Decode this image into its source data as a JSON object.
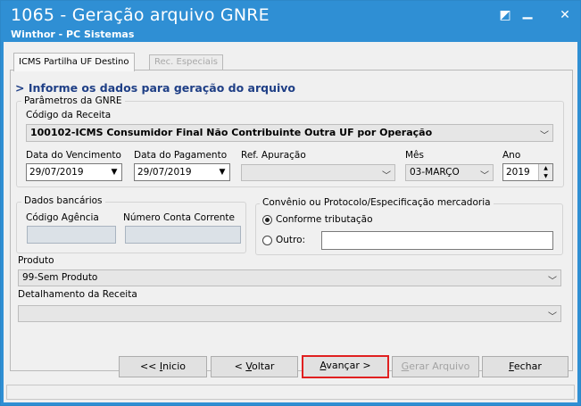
{
  "window": {
    "title": "1065 - Geração arquivo GNRE",
    "subtitle": "Winthor - PC Sistemas",
    "controls": {
      "restore": "◩",
      "minimize": "▁",
      "close": "✕"
    }
  },
  "tabs": [
    {
      "label": "ICMS Partilha UF Destino",
      "active": true
    },
    {
      "label": "Rec. Especiais",
      "active": false
    }
  ],
  "heading": "> Informe os dados para geração do arquivo",
  "parametros": {
    "group_label": "Parâmetros da GNRE",
    "codigo_receita_label": "Código da Receita",
    "codigo_receita_value": "100102-ICMS Consumidor Final Não Contribuinte Outra UF por Operação",
    "data_vencimento_label": "Data do Vencimento",
    "data_vencimento_value": "29/07/2019",
    "data_pagamento_label": "Data do Pagamento",
    "data_pagamento_value": "29/07/2019",
    "ref_apuracao_label": "Ref. Apuração",
    "ref_apuracao_value": "",
    "mes_label": "Mês",
    "mes_value": "03-MARÇO",
    "ano_label": "Ano",
    "ano_value": "2019"
  },
  "bancarios": {
    "group_label": "Dados bancários",
    "agencia_label": "Código Agência",
    "conta_label": "Número Conta Corrente"
  },
  "convenio": {
    "group_label": "Convênio ou Protocolo/Especificação mercadoria",
    "option1": "Conforme tributação",
    "option2": "Outro:",
    "selected": "Conforme tributação"
  },
  "produto": {
    "label": "Produto",
    "value": "99-Sem Produto"
  },
  "detalhamento": {
    "label": "Detalhamento da Receita",
    "value": ""
  },
  "buttons": {
    "inicio": {
      "prefix": "<< ",
      "key": "I",
      "rest": "nicio"
    },
    "voltar": {
      "prefix": "< ",
      "key": "V",
      "rest": "oltar"
    },
    "avancar": {
      "key": "A",
      "rest": "vançar >"
    },
    "gerar": {
      "key": "G",
      "rest": "erar Arquivo"
    },
    "fechar": {
      "key": "F",
      "rest": "echar"
    }
  },
  "colors": {
    "titlebar": "#2f8fd4",
    "heading": "#1f3f86",
    "focus_border": "#e02020"
  }
}
